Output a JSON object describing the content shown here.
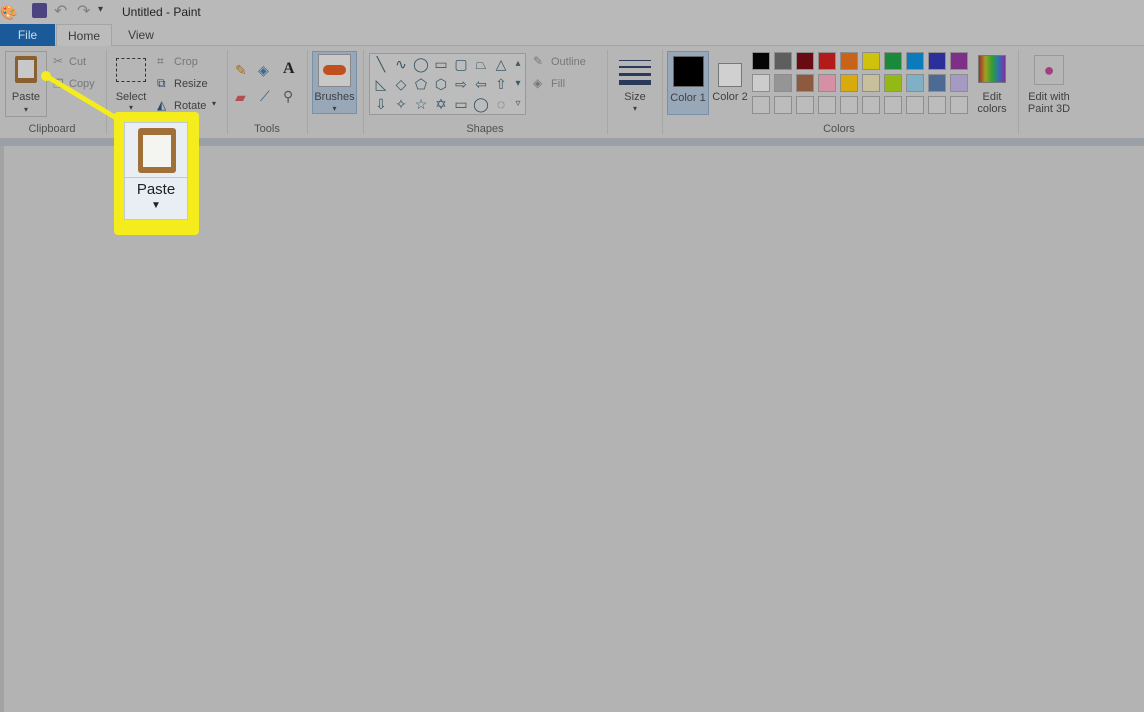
{
  "window": {
    "title": "Untitled - Paint"
  },
  "quick_access": {
    "icons": [
      "paint-app-icon",
      "save-icon",
      "undo-icon",
      "redo-icon",
      "customize-dropdown-icon"
    ]
  },
  "tabs": [
    {
      "label": "File",
      "active": false
    },
    {
      "label": "Home",
      "active": true
    },
    {
      "label": "View",
      "active": false
    }
  ],
  "clipboard": {
    "paste": "Paste",
    "cut": "Cut",
    "copy": "Copy",
    "group": "Clipboard"
  },
  "image": {
    "select": "Select",
    "crop": "Crop",
    "resize": "Resize",
    "rotate": "Rotate"
  },
  "tools": {
    "group": "Tools",
    "icons": [
      "pencil-icon",
      "fill-icon",
      "text-icon",
      "eraser-icon",
      "color-picker-icon",
      "magnifier-icon"
    ]
  },
  "brushes": {
    "label": "Brushes"
  },
  "shapes": {
    "group": "Shapes",
    "outline": "Outline",
    "fill": "Fill",
    "glyphs": [
      "╲",
      "∿",
      "◯",
      "▭",
      "▢",
      "⏢",
      "△",
      "◺",
      "◇",
      "⬠",
      "⬡",
      "⇨",
      "⇦",
      "⇧",
      "⇩",
      "✧",
      "☆",
      "✡",
      "▭",
      "◯",
      "◌"
    ]
  },
  "size": {
    "label": "Size"
  },
  "colors": {
    "group": "Colors",
    "color1": "Color 1",
    "color2": "Color 2",
    "edit": "Edit colors",
    "color1_value": "#000000",
    "color2_value": "#d0d0d0",
    "palette": [
      [
        "#050505",
        "#5e5e5e",
        "#6a0a12",
        "#b41a1a",
        "#c8641a",
        "#cfc20c",
        "#1a8a3a",
        "#0a7cbd",
        "#2c2f9a",
        "#7e2f86"
      ],
      [
        "#cccccc",
        "#959595",
        "#8e5a3e",
        "#d690a6",
        "#d9aa0c",
        "#c8c09a",
        "#94b814",
        "#7fb0c6",
        "#4c6a94",
        "#a59ac4"
      ],
      [
        "",
        "",
        "",
        "",
        "",
        "",
        "",
        "",
        "",
        ""
      ]
    ]
  },
  "paint3d": {
    "label": "Edit with Paint 3D"
  },
  "callout": {
    "label": "Paste",
    "highlight": "#f5ec1e"
  }
}
